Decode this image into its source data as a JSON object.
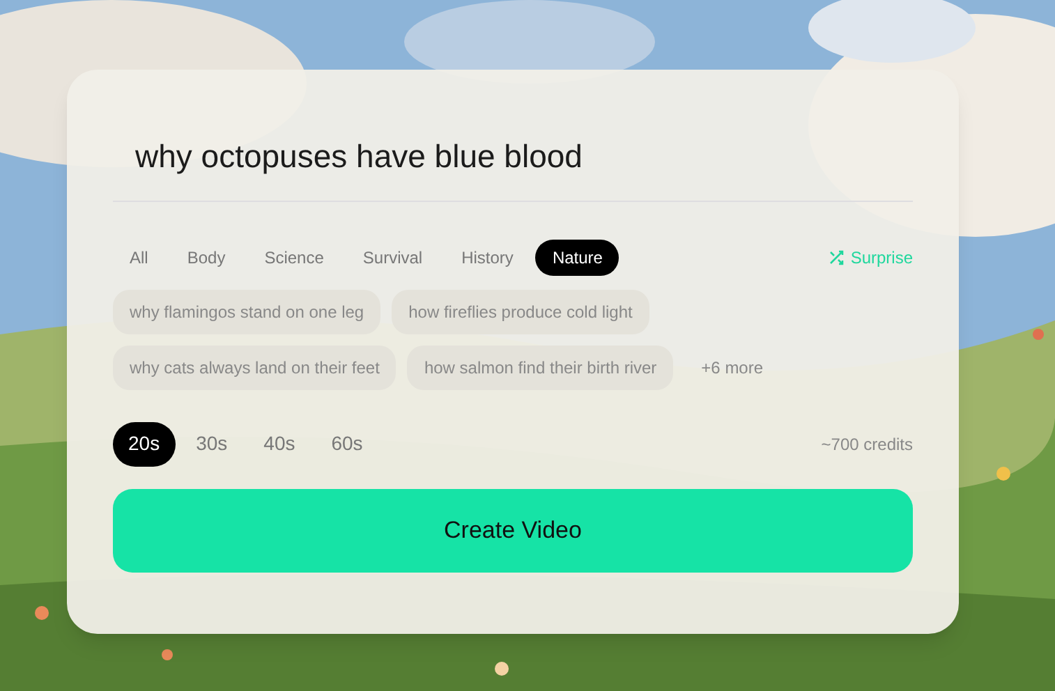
{
  "prompt": {
    "value": "why octopuses have blue blood"
  },
  "categories": [
    {
      "label": "All",
      "selected": false
    },
    {
      "label": "Body",
      "selected": false
    },
    {
      "label": "Science",
      "selected": false
    },
    {
      "label": "Survival",
      "selected": false
    },
    {
      "label": "History",
      "selected": false
    },
    {
      "label": "Nature",
      "selected": true
    }
  ],
  "surprise": {
    "label": "Surprise"
  },
  "suggestions": [
    [
      "why flamingos stand on one leg",
      "how fireflies produce cold light"
    ],
    [
      "why cats always land on their feet",
      "how salmon find their birth river"
    ]
  ],
  "more": "+6 more",
  "durations": [
    {
      "label": "20s",
      "selected": true
    },
    {
      "label": "30s",
      "selected": false
    },
    {
      "label": "40s",
      "selected": false
    },
    {
      "label": "60s",
      "selected": false
    }
  ],
  "credits": "~700 credits",
  "create_button": "Create Video"
}
